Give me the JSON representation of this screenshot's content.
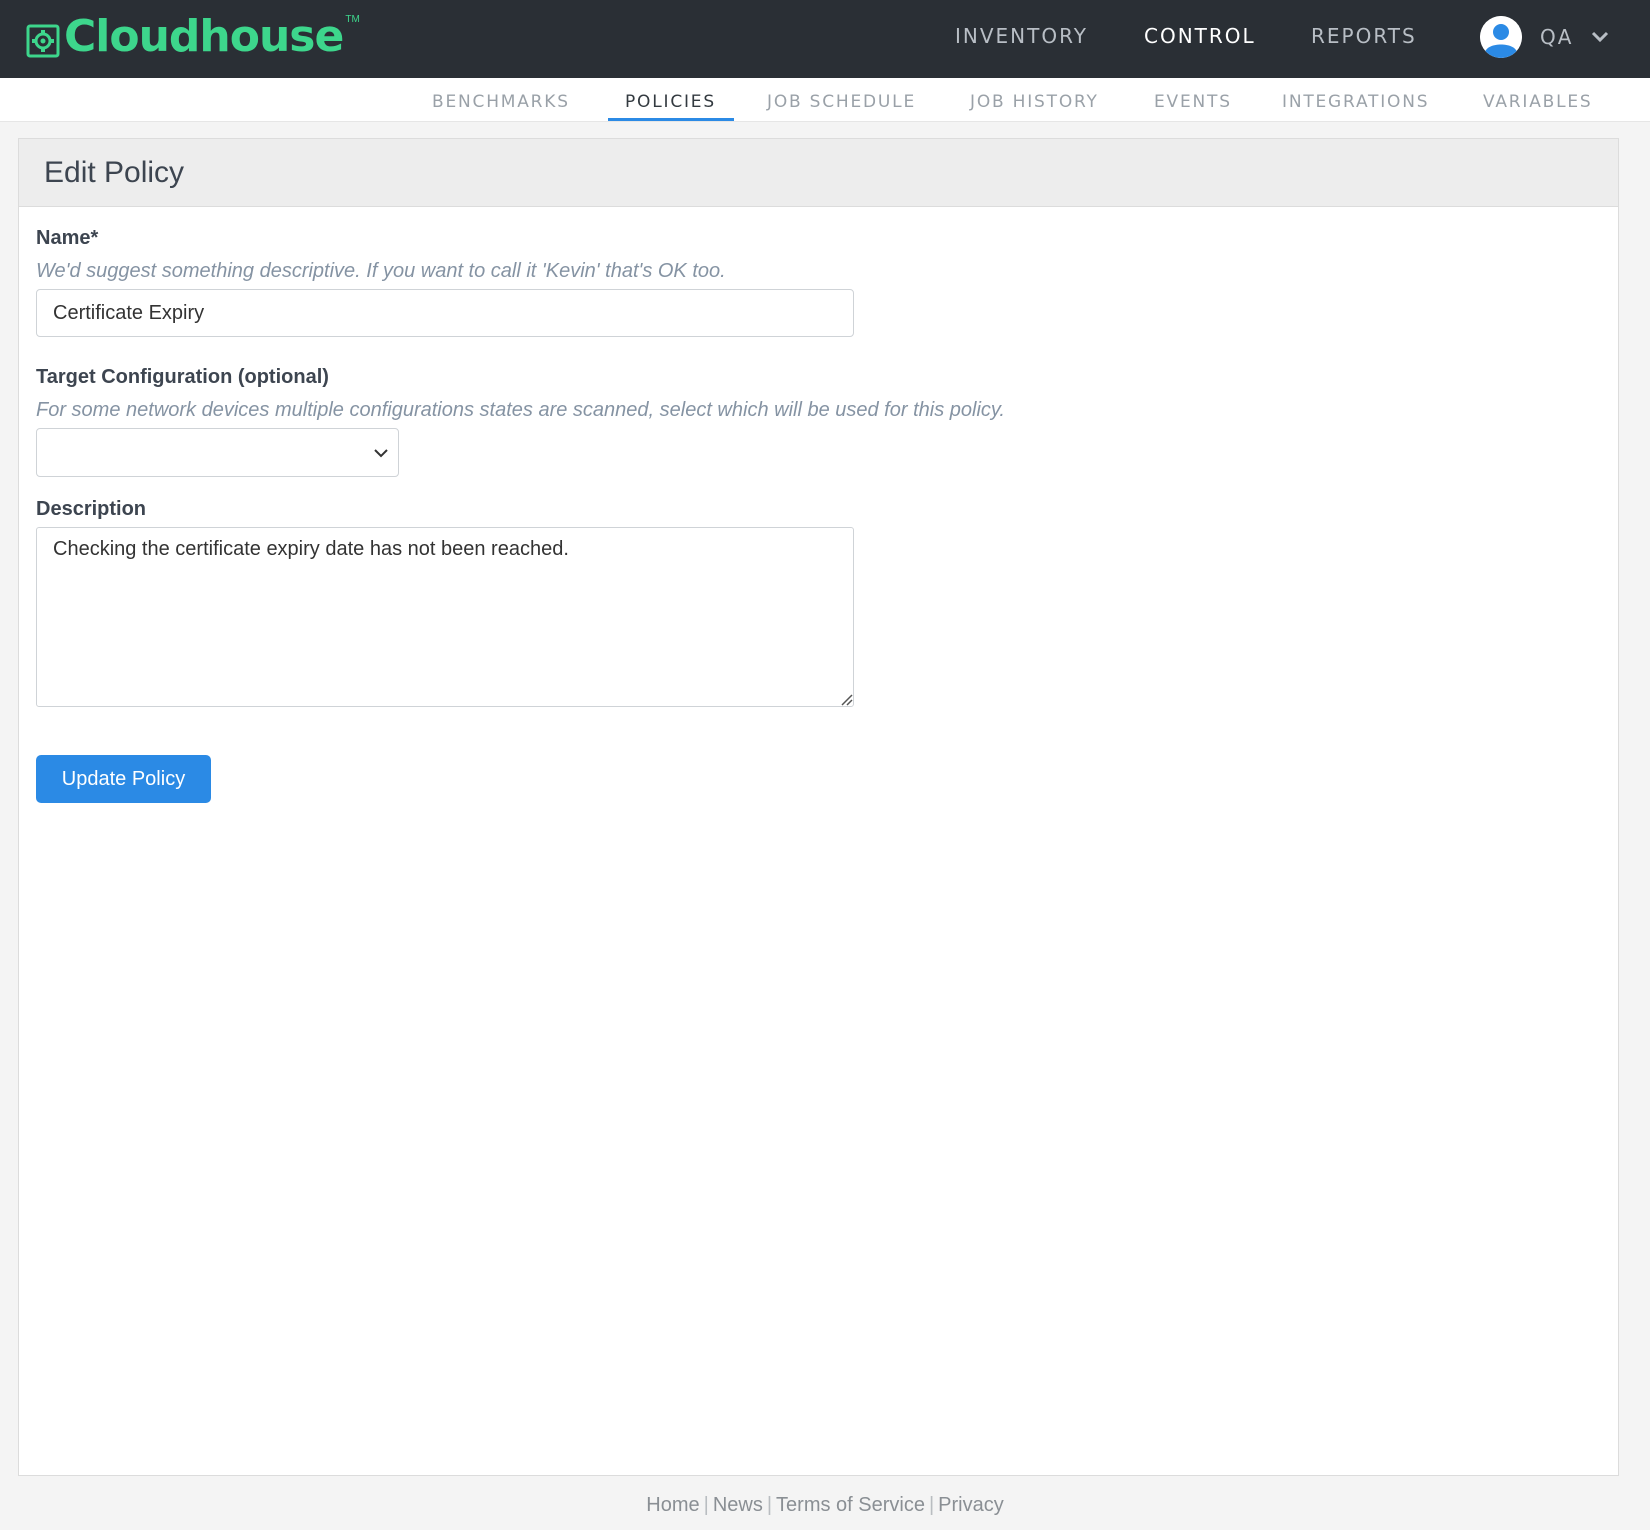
{
  "brand": {
    "name": "Cloudhouse",
    "trademark": "TM",
    "color": "#3dd68c"
  },
  "main_nav": {
    "items": [
      {
        "label": "INVENTORY",
        "active": false
      },
      {
        "label": "CONTROL",
        "active": true
      },
      {
        "label": "REPORTS",
        "active": false
      }
    ]
  },
  "user_menu": {
    "label": "QA",
    "icon": "user-avatar-icon"
  },
  "sub_nav": {
    "items": [
      {
        "label": "BENCHMARKS",
        "active": false
      },
      {
        "label": "POLICIES",
        "active": true
      },
      {
        "label": "JOB SCHEDULE",
        "active": false
      },
      {
        "label": "JOB HISTORY",
        "active": false
      },
      {
        "label": "EVENTS",
        "active": false
      },
      {
        "label": "INTEGRATIONS",
        "active": false
      },
      {
        "label": "VARIABLES",
        "active": false
      }
    ],
    "accent": "#2b8ae5"
  },
  "form": {
    "title": "Edit Policy",
    "name": {
      "label": "Name*",
      "help": "We'd suggest something descriptive. If you want to call it 'Kevin' that's OK too.",
      "value": "Certificate Expiry"
    },
    "target_configuration": {
      "label": "Target Configuration (optional)",
      "help": "For some network devices multiple configurations states are scanned, select which will be used for this policy.",
      "selected": ""
    },
    "description": {
      "label": "Description",
      "value": "Checking the certificate expiry date has not been reached."
    },
    "submit_label": "Update Policy"
  },
  "footer": {
    "links": [
      "Home",
      "News",
      "Terms of Service",
      "Privacy"
    ],
    "separator": "|"
  }
}
